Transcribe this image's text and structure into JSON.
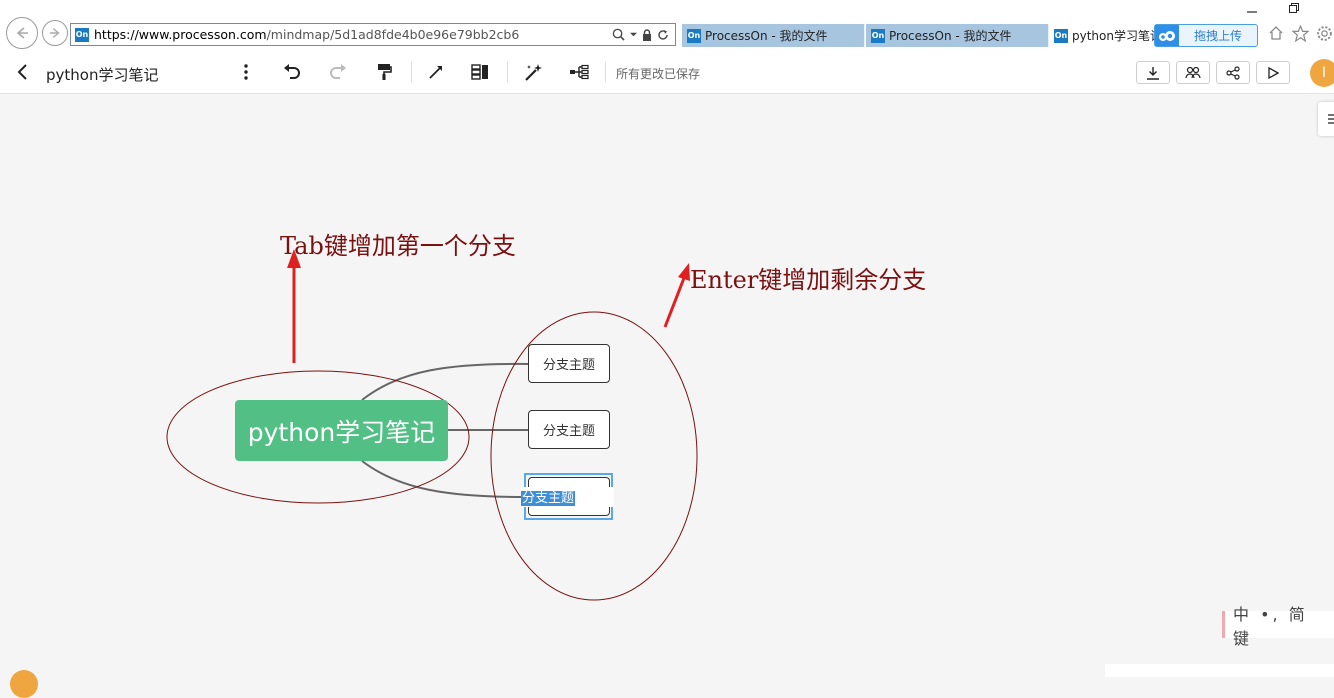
{
  "browser": {
    "url_host": "https://www.processon.com",
    "url_path": "/mindmap/5d1ad8fde4b0e96e79bb2cb6",
    "favicon_text": "On",
    "tabs": [
      {
        "label": "ProcessOn - 我的文件",
        "state": "inactive"
      },
      {
        "label": "ProcessOn - 我的文件",
        "state": "inactive"
      },
      {
        "label": "python学习笔记",
        "state": "active"
      }
    ],
    "upload_label": "拖拽上传"
  },
  "toolbar": {
    "title": "python学习笔记",
    "save_status": "所有更改已保存",
    "avatar_letter": "I",
    "icons": [
      "more-icon",
      "undo-icon",
      "redo-icon",
      "format-painter-icon",
      "connector-icon",
      "layout-icon",
      "magic-icon",
      "structure-icon"
    ],
    "right_icons": [
      "download-icon",
      "collaborate-icon",
      "share-icon",
      "play-icon"
    ]
  },
  "mindmap": {
    "root": "python学习笔记",
    "root_color": "#52c084",
    "branches": [
      "分支主题",
      "分支主题",
      "分支主题"
    ],
    "editing_text": "分支主题"
  },
  "annotations": {
    "tab_hint": "Tab键增加第一个分支",
    "enter_hint": "Enter键增加剩余分支",
    "color": "#7a1010",
    "arrow_color": "#e02020"
  },
  "ime": {
    "text": "中 •, 简 键"
  }
}
